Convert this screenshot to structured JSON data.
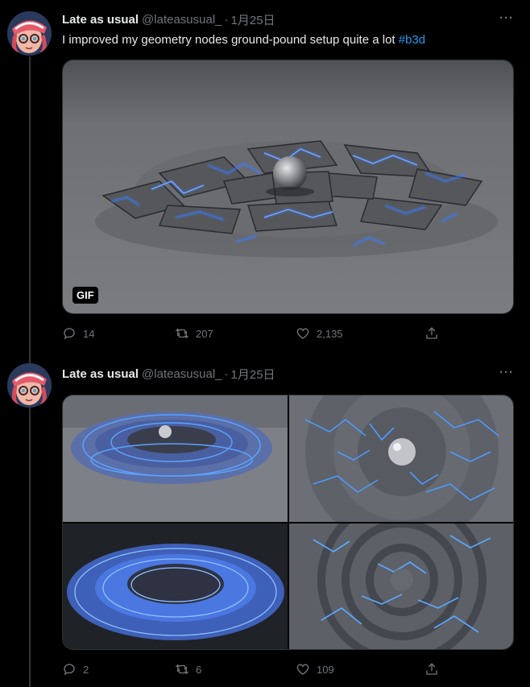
{
  "tweets": [
    {
      "name": "Late as usual",
      "handle": "@lateasusual_",
      "separator": "·",
      "date": "1月25日",
      "more": "···",
      "text": "I improved my geometry nodes ground-pound setup quite a lot ",
      "hashtag": "#b3d",
      "media_badge": "GIF",
      "replies": "14",
      "retweets": "207",
      "likes": "2,135"
    },
    {
      "name": "Late as usual",
      "handle": "@lateasusual_",
      "separator": "·",
      "date": "1月25日",
      "more": "···",
      "replies": "2",
      "retweets": "6",
      "likes": "109"
    }
  ],
  "colors": {
    "background": "#000000",
    "text": "#e7e9ea",
    "secondary": "#71767b",
    "link": "#1d9bf0",
    "crack_glow": "#3a7bff"
  },
  "icons": [
    "reply-icon",
    "retweet-icon",
    "like-icon",
    "share-icon",
    "more-icon"
  ]
}
